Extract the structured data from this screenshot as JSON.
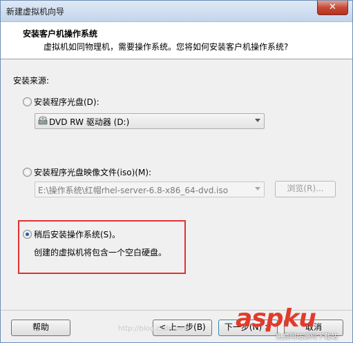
{
  "window": {
    "title": "新建虚拟机向导",
    "close_label": "✕"
  },
  "header": {
    "title": "安装客户机操作系统",
    "description": "虚拟机如同物理机，需要操作系统。您将如何安装客户机操作系统?"
  },
  "source_label": "安装来源:",
  "option_disc": {
    "label": "安装程序光盘(D):",
    "drive_value": "DVD RW 驱动器 (D:)"
  },
  "option_iso": {
    "label": "安装程序光盘映像文件(iso)(M):",
    "path_value": "E:\\操作系统\\红帽rhel-server-6.8-x86_64-dvd.iso",
    "browse_label": "浏览(R)..."
  },
  "option_later": {
    "label": "稍后安装操作系统(S)。",
    "description": "创建的虚拟机将包含一个空白硬盘。"
  },
  "footer": {
    "help_label": "帮助",
    "back_label": "< 上一步(B)",
    "next_label": "下一步(N) >",
    "cancel_label": "取消"
  },
  "watermark": "http://blog.csdn.net/",
  "logo": {
    "text": "aspku",
    "sub": "免费网站源码下载站"
  },
  "colors": {
    "highlight_box": "#e03030",
    "logo": "#e23b2b"
  }
}
